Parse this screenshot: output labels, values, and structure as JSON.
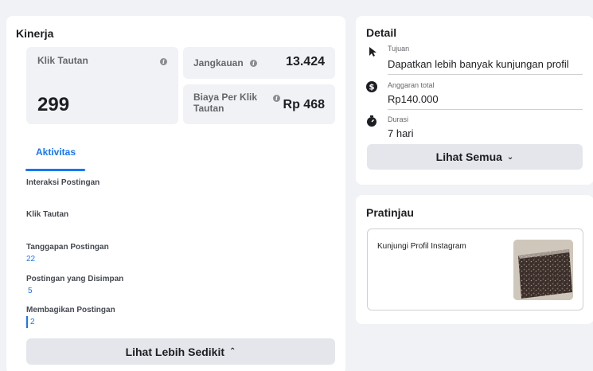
{
  "kinerja": {
    "title": "Kinerja",
    "klik_tautan": {
      "label": "Klik Tautan",
      "value": "299"
    },
    "jangkauan": {
      "label": "Jangkauan",
      "value": "13.424"
    },
    "biaya": {
      "label": "Biaya Per Klik Tautan",
      "value": "Rp 468"
    }
  },
  "aktivitas": {
    "tab_label": "Aktivitas",
    "metrics": [
      {
        "label": "Interaksi Postingan",
        "value": ""
      },
      {
        "label": "Klik Tautan",
        "value": ""
      },
      {
        "label": "Tanggapan Postingan",
        "value": "22"
      },
      {
        "label": "Postingan yang Disimpan",
        "value": "5"
      },
      {
        "label": "Membagikan Postingan",
        "value": "2"
      }
    ],
    "less_button": "Lihat Lebih Sedikit"
  },
  "detail": {
    "title": "Detail",
    "items": [
      {
        "small": "Tujuan",
        "main": "Dapatkan lebih banyak kunjungan profil",
        "icon": "cursor-icon"
      },
      {
        "small": "Anggaran total",
        "main": "Rp140.000",
        "icon": "dollar-icon"
      },
      {
        "small": "Durasi",
        "main": "7 hari",
        "icon": "stopwatch-icon"
      }
    ],
    "see_all_button": "Lihat Semua"
  },
  "pratinjau": {
    "title": "Pratinjau",
    "preview_text": "Kunjungi Profil Instagram"
  }
}
